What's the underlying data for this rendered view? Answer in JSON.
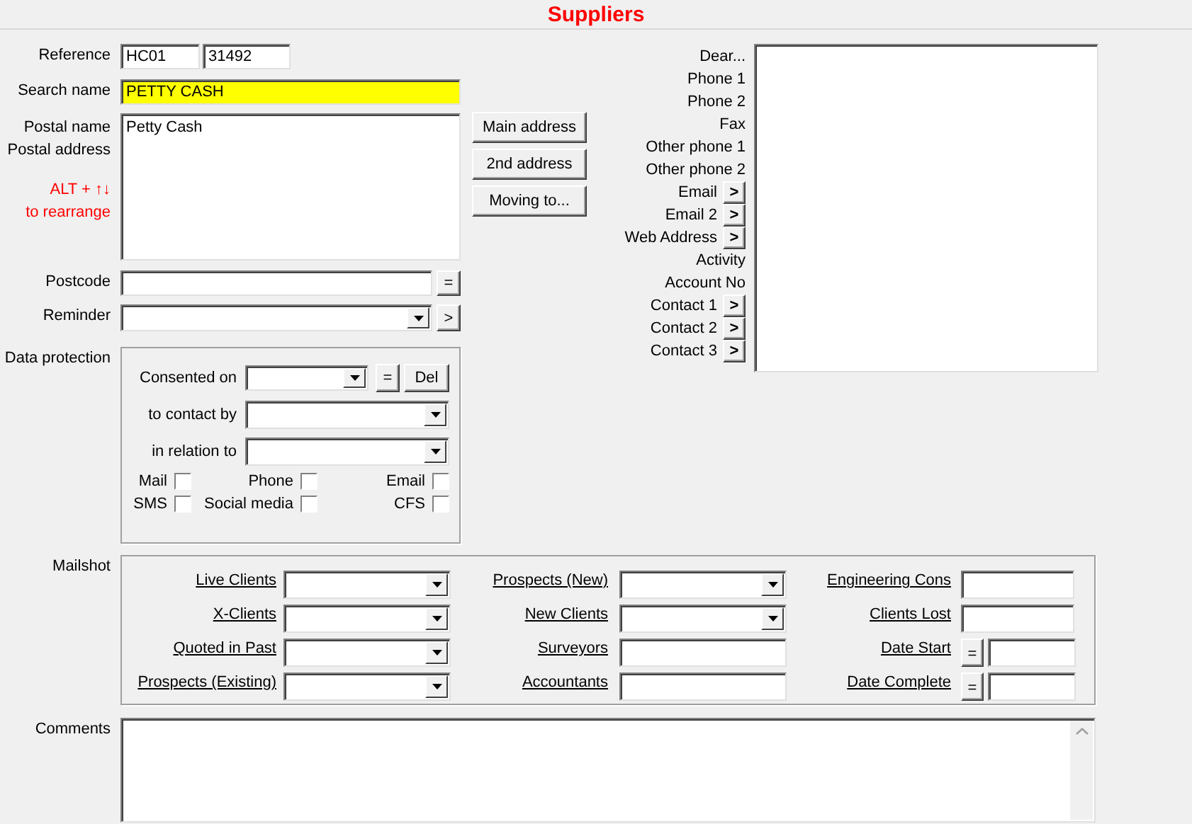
{
  "window": {
    "title": "Suppliers"
  },
  "reference": {
    "label": "Reference",
    "values": [
      "HC01",
      "31492"
    ]
  },
  "search_name": {
    "label": "Search name",
    "value": "PETTY CASH"
  },
  "postal": {
    "labels": [
      "Postal name",
      "Postal address"
    ],
    "hint_lines": [
      "ALT +  ↑↓",
      "to rearrange"
    ],
    "value": "Petty Cash"
  },
  "postcode": {
    "label": "Postcode",
    "button": "="
  },
  "reminder": {
    "label": "Reminder",
    "button": ">"
  },
  "address_buttons": [
    "Main address",
    "2nd address",
    "Moving to..."
  ],
  "data_protection": {
    "label": "Data protection",
    "consented_on": {
      "label": "Consented on",
      "buttons": [
        "=",
        "Del"
      ]
    },
    "dropdowns": [
      {
        "label": "to contact by"
      },
      {
        "label": "in relation to"
      }
    ],
    "checkboxes": [
      {
        "label": "Mail",
        "checked": false
      },
      {
        "label": "Phone",
        "checked": false
      },
      {
        "label": "Email",
        "checked": false
      },
      {
        "label": "SMS",
        "checked": false
      },
      {
        "label": "Social media",
        "checked": false
      },
      {
        "label": "CFS",
        "checked": false
      }
    ]
  },
  "contact_fields": [
    {
      "label": "Dear..."
    },
    {
      "label": "Phone 1"
    },
    {
      "label": "Phone 2"
    },
    {
      "label": "Fax"
    },
    {
      "label": "Other phone 1"
    },
    {
      "label": "Other phone 2"
    },
    {
      "label": "Email",
      "button": ">"
    },
    {
      "label": "Email 2",
      "button": ">"
    },
    {
      "label": "Web Address",
      "button": ">"
    },
    {
      "label": "Activity"
    },
    {
      "label": "Account No"
    },
    {
      "label": "Contact 1",
      "button": ">"
    },
    {
      "label": "Contact 2",
      "button": ">"
    },
    {
      "label": "Contact 3",
      "button": ">"
    }
  ],
  "mailshot": {
    "label": "Mailshot",
    "fields": [
      {
        "label": "Live Clients",
        "kind": "dropdown"
      },
      {
        "label": "Prospects (New)",
        "kind": "dropdown"
      },
      {
        "label": "Engineering Cons",
        "kind": "text"
      },
      {
        "label": "X-Clients",
        "kind": "dropdown"
      },
      {
        "label": "New Clients",
        "kind": "dropdown"
      },
      {
        "label": "Clients Lost",
        "kind": "text"
      },
      {
        "label": "Quoted in Past",
        "kind": "dropdown"
      },
      {
        "label": "Surveyors",
        "kind": "text"
      },
      {
        "label": "Date Start",
        "kind": "date",
        "button": "="
      },
      {
        "label": "Prospects (Existing)",
        "kind": "dropdown"
      },
      {
        "label": "Accountants",
        "kind": "text"
      },
      {
        "label": "Date Complete",
        "kind": "date",
        "button": "="
      }
    ]
  },
  "comments": {
    "label": "Comments"
  }
}
